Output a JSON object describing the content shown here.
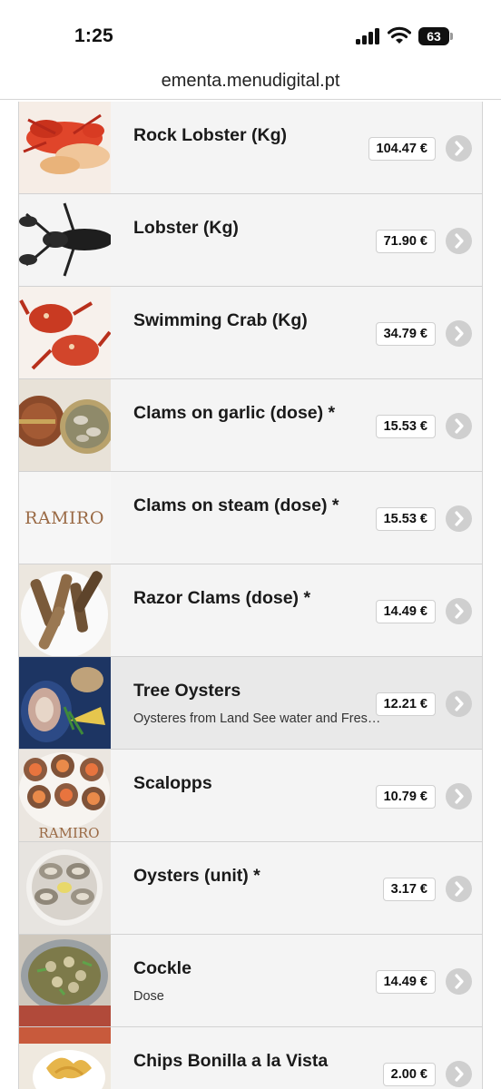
{
  "status_bar": {
    "time": "1:25",
    "battery": "63"
  },
  "browser": {
    "url": "ementa.menudigital.pt"
  },
  "items": [
    {
      "name": "Rock Lobster (Kg)",
      "desc": "",
      "price": "104.47 €",
      "image": "lobster-photo"
    },
    {
      "name": "Lobster (Kg)",
      "desc": "",
      "price": "71.90 €",
      "image": "black-lobster-photo"
    },
    {
      "name": "Swimming Crab (Kg)",
      "desc": "",
      "price": "34.79 €",
      "image": "crab-photo"
    },
    {
      "name": "Clams on garlic (dose) *",
      "desc": "",
      "price": "15.53 €",
      "image": "clams-pan-photo"
    },
    {
      "name": "Clams on steam (dose) *",
      "desc": "",
      "price": "15.53 €",
      "image": "ramiro-logo",
      "logo_text": "RAMIRO"
    },
    {
      "name": "Razor Clams (dose) *",
      "desc": "",
      "price": "14.49 €",
      "image": "razor-clams-photo"
    },
    {
      "name": "Tree Oysters",
      "desc": "Oysteres from Land See water and Fres…",
      "price": "12.21 €",
      "image": "oyster-blue-photo"
    },
    {
      "name": "Scalopps",
      "desc": "",
      "price": "10.79 €",
      "image": "scallops-photo",
      "logo_text": "RAMIRO"
    },
    {
      "name": "Oysters (unit) *",
      "desc": "",
      "price": "3.17 €",
      "image": "oysters-plate-photo"
    },
    {
      "name": "Cockle",
      "desc": "Dose",
      "price": "14.49 €",
      "image": "cockle-pot-photo"
    },
    {
      "name": "Chips Bonilla a la Vista",
      "desc": "",
      "price": "2.00 €",
      "image": "chips-photo"
    }
  ],
  "colors": {
    "row_bg": "#f4f4f4",
    "highlight_bg": "#e9e9e9",
    "arrow_bg": "#cfcfcf"
  }
}
